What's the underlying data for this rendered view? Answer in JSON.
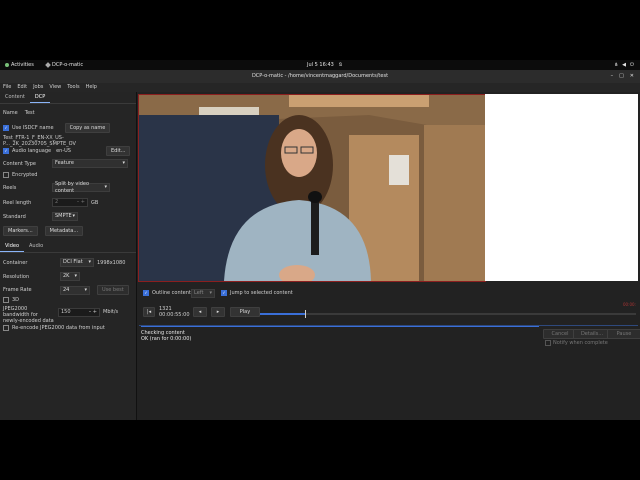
{
  "topbar": {
    "activities": "Activities",
    "app_name": "DCP-o-matic",
    "clock": "Jul 5  16:43"
  },
  "window": {
    "title": "DCP-o-matic - /home/vincentmaggard/Documents/test"
  },
  "menu": [
    "File",
    "Edit",
    "Jobs",
    "View",
    "Tools",
    "Help"
  ],
  "left": {
    "tabs": [
      "Content",
      "DCP"
    ],
    "name_label": "Name",
    "name_value": "Test",
    "use_isdcf": "Use ISDCF name",
    "copy_as_name": "Copy as name",
    "dcp_name": "Test_FTR-1_F_EN-XX_US-P..._2K_20230705_SMPTE_OV",
    "audio_language_label": "Audio language",
    "audio_language_value": "en-US",
    "edit": "Edit...",
    "content_type_label": "Content Type",
    "content_type_value": "Feature",
    "encrypted": "Encrypted",
    "reels_label": "Reels",
    "reels_value": "Split by video content",
    "reel_length_label": "Reel length",
    "reel_length_value": "2",
    "reel_length_unit": "GB",
    "standard_label": "Standard",
    "standard_value": "SMPTE",
    "markers": "Markers...",
    "metadata": "Metadata...",
    "sub_tabs": [
      "Video",
      "Audio"
    ],
    "container_label": "Container",
    "container_value": "DCI Flat",
    "container_res": "1998x1080",
    "resolution_label": "Resolution",
    "resolution_value": "2K",
    "frame_rate_label": "Frame Rate",
    "frame_rate_value": "24",
    "use_best": "Use best",
    "three_d": "3D",
    "bandwidth_label": "JPEG2000 bandwidth for newly-encoded data",
    "bandwidth_value": "150",
    "bandwidth_unit": "Mbit/s",
    "reencode": "Re-encode JPEG2000 data from input"
  },
  "player": {
    "outline_content": "Outline content",
    "eye": "Left",
    "jump_selected": "Jump to selected content",
    "frame": "1321",
    "timecode": "00:00:55:00",
    "play": "Play",
    "progress": 0.12,
    "end_timecode": "00:00:"
  },
  "jobs": {
    "title": "Checking content",
    "status": "OK (ran for 0:00:00)",
    "cancel": "Cancel",
    "details": "Details...",
    "pause": "Pause",
    "notify": "Notify when complete"
  }
}
